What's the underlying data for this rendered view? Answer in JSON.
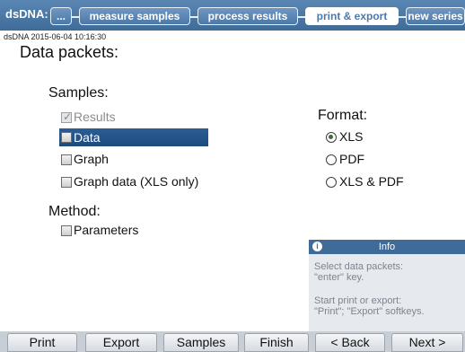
{
  "header": {
    "app_title": "dsDNA:",
    "tabs": [
      {
        "label": "..."
      },
      {
        "label": "measure samples"
      },
      {
        "label": "process results"
      },
      {
        "label": "print & export"
      },
      {
        "label": "new series"
      }
    ],
    "active_tab": "print & export"
  },
  "subheader": "dsDNA 2015-06-04 10:16:30",
  "page_title": "Data packets:",
  "samples": {
    "title": "Samples:",
    "items": [
      {
        "label": "Results",
        "checked": true,
        "disabled": true
      },
      {
        "label": "Data",
        "checked": false,
        "selected": true
      },
      {
        "label": "Graph",
        "checked": false
      },
      {
        "label": "Graph data (XLS only)",
        "checked": false
      }
    ]
  },
  "method": {
    "title": "Method:",
    "items": [
      {
        "label": "Parameters",
        "checked": false
      }
    ]
  },
  "format": {
    "title": "Format:",
    "options": [
      {
        "label": "XLS",
        "selected": true
      },
      {
        "label": "PDF",
        "selected": false
      },
      {
        "label": "XLS & PDF",
        "selected": false
      }
    ]
  },
  "info": {
    "title": "Info",
    "line1": "Select data packets:",
    "line2": "\"enter\" key.",
    "line3": "Start print or export:",
    "line4": "\"Print\"; \"Export\" softkeys."
  },
  "softkeys": {
    "print": "Print",
    "export": "Export",
    "samples": "Samples",
    "finish": "Finish",
    "back": "< Back",
    "next": "Next >"
  },
  "colors": {
    "header": "#3f6b98",
    "selection": "#1d4b7e",
    "info_text": "#7d8590"
  }
}
